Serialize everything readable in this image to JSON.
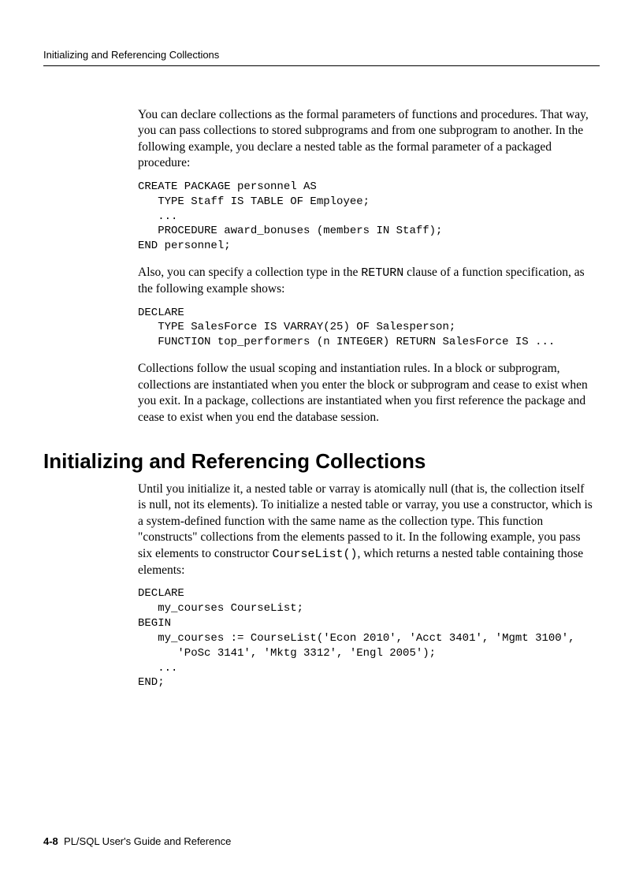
{
  "header": {
    "running_title": "Initializing and Referencing Collections"
  },
  "body": {
    "para1": "You can declare collections as the formal parameters of functions and procedures. That way, you can pass collections to stored subprograms and from one subprogram to another. In the following example, you declare a nested table as the formal parameter of a packaged procedure:",
    "code1": "CREATE PACKAGE personnel AS\n   TYPE Staff IS TABLE OF Employee;\n   ...\n   PROCEDURE award_bonuses (members IN Staff);\nEND personnel;",
    "para2_pre": "Also, you can specify a collection type in the ",
    "para2_code": "RETURN",
    "para2_post": " clause of a function specification, as the following example shows:",
    "code2": "DECLARE\n   TYPE SalesForce IS VARRAY(25) OF Salesperson;\n   FUNCTION top_performers (n INTEGER) RETURN SalesForce IS ...",
    "para3": "Collections follow the usual scoping and instantiation rules. In a block or subprogram, collections are instantiated when you enter the block or subprogram and cease to exist when you exit. In a package, collections are instantiated when you first reference the package and cease to exist when you end the database session.",
    "section_heading": "Initializing and Referencing Collections",
    "para4_pre": "Until you initialize it, a nested table or varray is atomically null (that is, the collection itself is null, not its elements). To initialize a nested table or varray, you use a constructor, which is a system-defined function with the same name as the collection type. This function \"constructs\" collections from the elements passed to it. In the following example, you pass six elements to constructor ",
    "para4_code": "CourseList()",
    "para4_post": ", which returns a nested table containing those elements:",
    "code3": "DECLARE\n   my_courses CourseList;\nBEGIN\n   my_courses := CourseList('Econ 2010', 'Acct 3401', 'Mgmt 3100',\n      'PoSc 3141', 'Mktg 3312', 'Engl 2005');\n   ...\nEND;"
  },
  "footer": {
    "page_number": "4-8",
    "book_title": "PL/SQL User's Guide and Reference"
  }
}
